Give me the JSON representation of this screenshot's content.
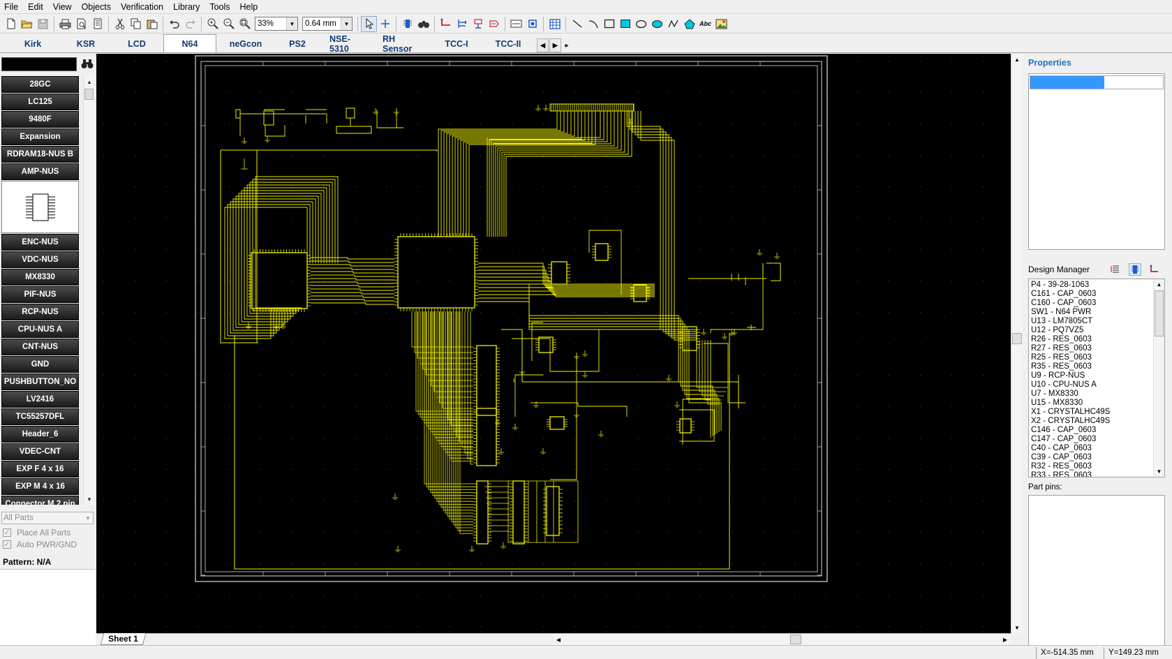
{
  "menu": [
    "File",
    "Edit",
    "View",
    "Objects",
    "Verification",
    "Library",
    "Tools",
    "Help"
  ],
  "toolbar": {
    "zoom_value": "33%",
    "width_value": "0.64 mm",
    "text_tool_label": "Abc",
    "buttons_left": [
      "new-file-icon",
      "open-folder-icon",
      "save-icon"
    ],
    "buttons_print": [
      "print-icon",
      "print-preview-icon",
      "page-setup-icon"
    ],
    "buttons_edit": [
      "cut-icon",
      "copy-icon",
      "paste-icon"
    ],
    "buttons_undo": [
      "undo-icon",
      "redo-icon"
    ],
    "buttons_zoom": [
      "zoom-in-icon",
      "zoom-out-icon",
      "zoom-fit-icon"
    ]
  },
  "library_tabs": [
    "Kirk",
    "KSR",
    "LCD",
    "N64",
    "neGcon",
    "PS2",
    "NSE-5310",
    "RH Sensor",
    "TCC-I",
    "TCC-II"
  ],
  "active_library_tab": "N64",
  "parts_top": [
    "28GC",
    "LC125",
    "9480F",
    "Expansion",
    "RDRAM18-NUS B",
    "AMP-NUS"
  ],
  "parts_bottom": [
    "ENC-NUS",
    "VDC-NUS",
    "MX8330",
    "PIF-NUS",
    "RCP-NUS",
    "CPU-NUS A",
    "CNT-NUS",
    "GND",
    "PUSHBUTTON_NO",
    "LV2416",
    "TC55257DFL",
    "Header_6",
    "VDEC-CNT",
    "EXP F 4 x 16",
    "EXP M 4 x 16",
    "Connector M 2 pin"
  ],
  "left_panel": {
    "filter_value": "All Parts",
    "place_all_label": "Place All Parts",
    "auto_pwr_label": "Auto PWR/GND",
    "pattern_label": "Pattern: N/A"
  },
  "canvas": {
    "sheet_tab": "Sheet 1",
    "trace_color": "#f0f000",
    "background": "#000000"
  },
  "right_panel": {
    "properties_title": "Properties",
    "design_manager_label": "Design Manager",
    "part_pins_label": "Part pins:",
    "design_items": [
      "P4 - 39-28-1063",
      "C161 - CAP_0603",
      "C160 - CAP_0603",
      "SW1 - N64 PWR",
      "U13 - LM7805CT",
      "U12 - PQ7VZ5",
      "R26 - RES_0603",
      "R27 - RES_0603",
      "R25 - RES_0603",
      "R35 - RES_0603",
      "U9 - RCP-NUS",
      "U10 - CPU-NUS A",
      "U7 - MX8330",
      "U15 - MX8330",
      "X1 - CRYSTALHC49S",
      "X2 - CRYSTALHC49S",
      "C146 - CAP_0603",
      "C147 - CAP_0603",
      "C40 - CAP_0603",
      "C39 - CAP_0603",
      "R32 - RES_0603",
      "R33 - RES_0603"
    ]
  },
  "status": {
    "x_coord": "X=-514.35 mm",
    "y_coord": "Y=149.23 mm"
  }
}
